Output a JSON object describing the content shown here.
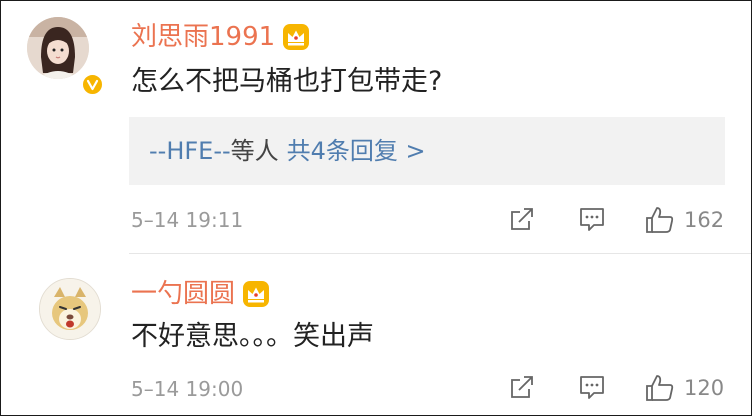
{
  "comments": [
    {
      "username": "刘思雨1991",
      "text": "怎么不把马桶也打包带走?",
      "replies": {
        "user": "--HFE--",
        "rest": "等人",
        "count_text": "共4条回复 >"
      },
      "time": "5–14 19:11",
      "likes": "162",
      "verified": true
    },
    {
      "username": "一勺圆圆",
      "text": "不好意思。。。笑出声",
      "time": "5–14 19:00",
      "likes": "120",
      "verified": false
    }
  ],
  "colors": {
    "username": "#eb7350",
    "link": "#507daf",
    "crown": "#f7b500",
    "meta": "#9a9a9a"
  },
  "icons": [
    "crown-vip-icon",
    "verified-badge-icon",
    "share-icon",
    "reply-icon",
    "like-icon"
  ]
}
